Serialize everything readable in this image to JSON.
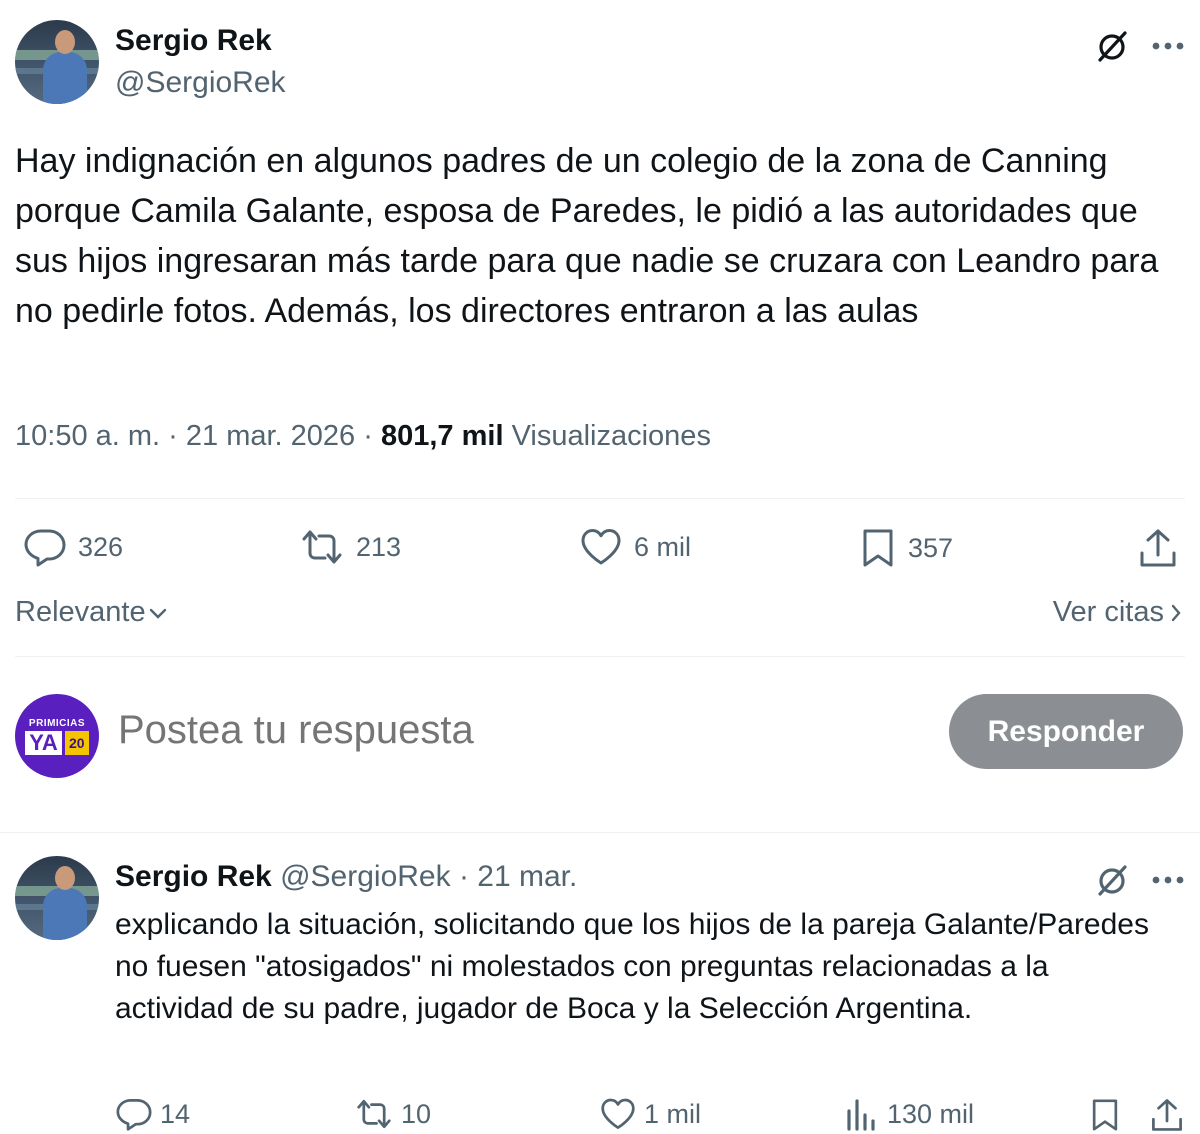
{
  "main_tweet": {
    "author_name": "Sergio Rek",
    "author_handle": "@SergioRek",
    "more_icon": "more-dots-icon",
    "grok_icon": "grok-slash-circle-icon",
    "text": "Hay indignación en algunos padres de un colegio de la zona de Canning porque Camila Galante, esposa de Paredes, le pidió a las autoridades que sus hijos ingresaran más tarde para que nadie se cruzara con Leandro para no pedirle fotos. Además, los directores entraron a las aulas",
    "time": "10:50 a. m.",
    "sep1": "·",
    "date": "21 mar. 2026",
    "sep2": "·",
    "views_count": "801,7 mil",
    "views_label": "Visualizaciones",
    "replies": "326",
    "reposts": "213",
    "likes": "6 mil",
    "bookmarks": "357"
  },
  "sort": {
    "label": "Relevante",
    "quotes_label": "Ver citas"
  },
  "composer": {
    "avatar_top": "PRIMICIAS",
    "avatar_ya": "YA",
    "avatar_num": "20",
    "placeholder": "Postea tu respuesta",
    "button_label": "Responder"
  },
  "reply_tweet": {
    "author_name": "Sergio Rek",
    "author_handle": "@SergioRek",
    "sep": "·",
    "date": "21 mar.",
    "text": "explicando la situación, solicitando que los hijos de la pareja Galante/Paredes no fuesen \"atosigados\" ni molestados con preguntas relacionadas a la actividad de su padre, jugador de Boca y la Selección Argentina.",
    "replies": "14",
    "reposts": "10",
    "likes": "1 mil",
    "views": "130 mil"
  },
  "colors": {
    "text": "#0f1419",
    "secondary": "#536471",
    "divider": "#eff3f4",
    "button_disabled": "#8b8f93",
    "composer_avatar": "#5a1fbf"
  }
}
